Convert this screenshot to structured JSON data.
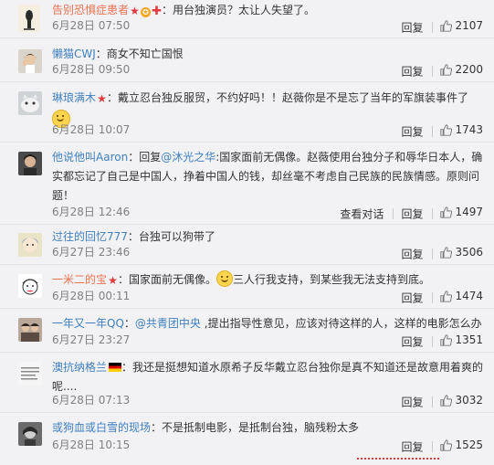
{
  "labels": {
    "reply": "回复",
    "view_conversation": "查看对话"
  },
  "comments": [
    {
      "user": "告别恐惧症患者",
      "text": "：用台独演员？太让人失望了。",
      "time": "6月28日 07:50",
      "likes": "2107"
    },
    {
      "user": "懒猫CWJ",
      "text": "：商女不知亡国恨",
      "time": "6月28日 09:50",
      "likes": "2200"
    },
    {
      "user": "琳琅满木",
      "text": "：戴立忍台独反服贸，不约好吗！！赵薇你是不是忘了当年的军旗装事件了",
      "time": "6月28日 10:07",
      "likes": "1743"
    },
    {
      "user": "他说他叫Aaron",
      "text_pre": "：回复",
      "mention": "@沐光之华",
      "text": ":国家面前无偶像。赵薇使用台独分子和辱华日本人，确实都忘记了自己是中国人，挣着中国人的钱，却丝毫不考虑自己民族的民族情感。原则问题！",
      "time": "6月28日 12:46",
      "likes": "1497"
    },
    {
      "user": "过往的回忆777",
      "text": "：台独可以狗带了",
      "time": "6月27日 23:46",
      "likes": "3506"
    },
    {
      "user": "一米二的宝",
      "text": "：国家面前无偶像。",
      "text_after": "三人行我支持，到某些我无法支持到底。",
      "time": "6月28日 00:11",
      "likes": "1474"
    },
    {
      "user": "一年又一年QQ",
      "text_pre": "：",
      "mention": "@共青团中央",
      "text": " ,提出指导性意见，应该对待这样的人，这样的电影怎么办",
      "time": "6月27日 23:27",
      "likes": "1351"
    },
    {
      "user": "澳抗纳格兰",
      "text": "：我还是挺想知道水原希子反华戴立忍台独你是真不知道还是故意用着爽的呢....",
      "time": "6月28日 07:13",
      "likes": "3032"
    },
    {
      "user": "或狗血或白雪的现场",
      "text": "：不是抵制电影，是抵制台独，脑残粉太多",
      "time": "6月28日 10:15",
      "likes": "1525"
    }
  ]
}
